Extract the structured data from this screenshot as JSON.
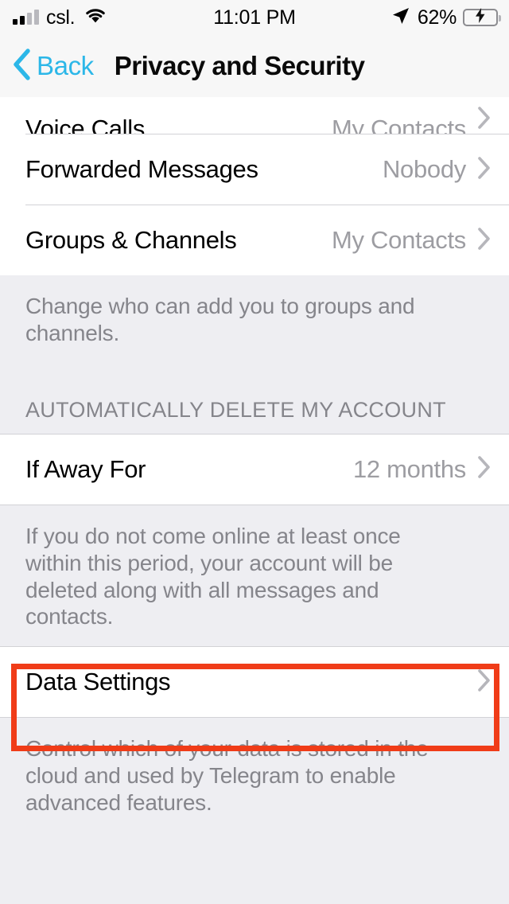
{
  "status_bar": {
    "carrier": "csl.",
    "time": "11:01 PM",
    "battery_percent": "62%",
    "battery_level": 62,
    "charging": true,
    "signal_bars_filled": 2,
    "signal_bars_total": 4,
    "icons": {
      "wifi": "wifi-icon",
      "location": "location-arrow-icon",
      "battery": "battery-charging-icon"
    }
  },
  "nav": {
    "back_label": "Back",
    "title": "Privacy and Security"
  },
  "sections": [
    {
      "id": "privacy-visibility",
      "header": null,
      "rows": [
        {
          "title": "Voice Calls",
          "value": "My Contacts",
          "clipped": true
        },
        {
          "title": "Forwarded Messages",
          "value": "Nobody",
          "clipped": false
        },
        {
          "title": "Groups & Channels",
          "value": "My Contacts",
          "clipped": false
        }
      ],
      "footnote": "Change who can add you to groups and channels."
    },
    {
      "id": "auto-delete-account",
      "header": "AUTOMATICALLY DELETE MY ACCOUNT",
      "rows": [
        {
          "title": "If Away For",
          "value": "12 months",
          "clipped": false
        }
      ],
      "footnote": "If you do not come online at least once within this period, your account will be deleted along with all messages and contacts."
    },
    {
      "id": "data-settings",
      "header": null,
      "rows": [
        {
          "title": "Data Settings",
          "value": "",
          "clipped": false,
          "highlighted": true
        }
      ],
      "footnote": "Control which of your data is stored in the cloud and used by Telegram to enable advanced features."
    }
  ],
  "annotation": {
    "name": "data-settings-highlight",
    "color": "#f03c18",
    "target": "Data Settings"
  },
  "colors": {
    "accent": "#2cb7e8",
    "background": "#eeeef2",
    "row_background": "#ffffff",
    "secondary_text": "#85858b",
    "value_text": "#9d9da2",
    "separator": "#d2d2d6",
    "battery_green": "#32d74b",
    "annotation_red": "#f03c18"
  }
}
